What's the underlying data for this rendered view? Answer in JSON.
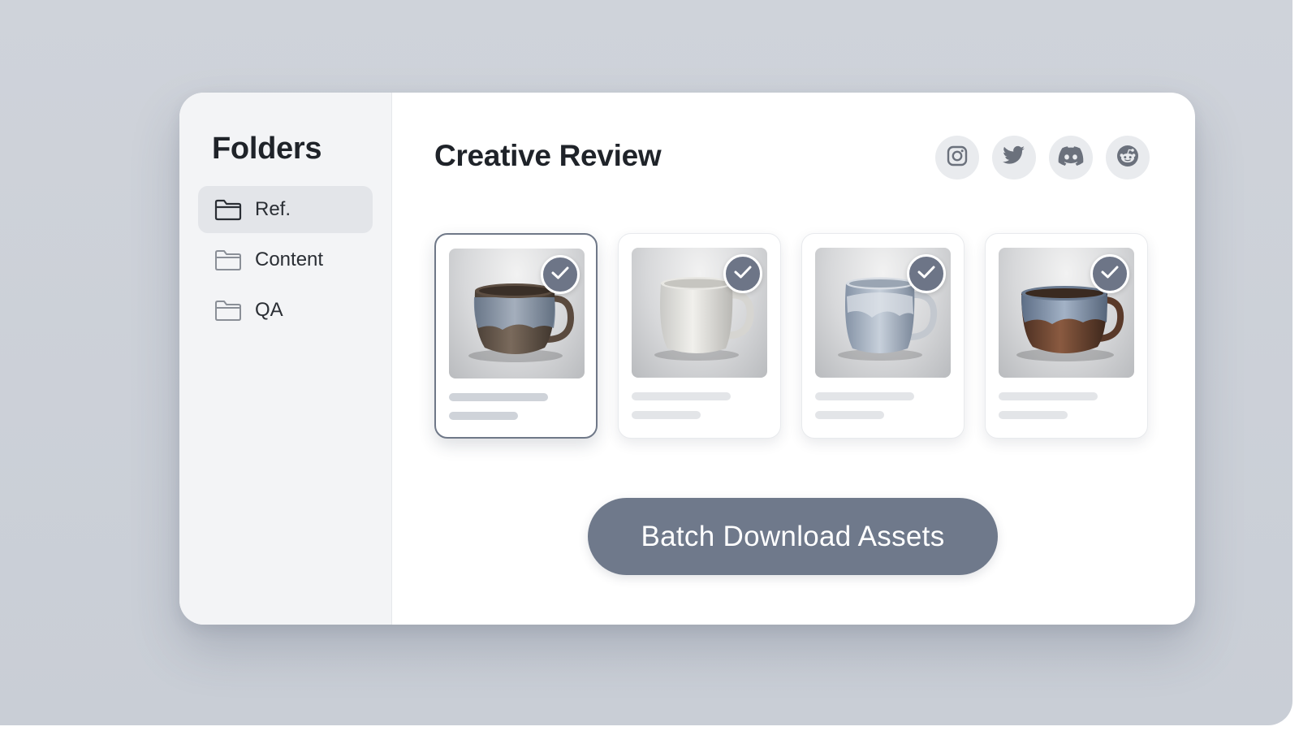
{
  "sidebar": {
    "title": "Folders",
    "items": [
      {
        "label": "Ref.",
        "icon": "folder-icon",
        "active": true
      },
      {
        "label": "Content",
        "icon": "folder-icon",
        "active": false
      },
      {
        "label": "QA",
        "icon": "folder-icon",
        "active": false
      }
    ]
  },
  "header": {
    "title": "Creative Review",
    "social": [
      "instagram-icon",
      "twitter-icon",
      "discord-icon",
      "reddit-icon"
    ]
  },
  "cards": [
    {
      "selected": true,
      "checked": true,
      "mug": "speckled-brown-blue-mug"
    },
    {
      "selected": false,
      "checked": true,
      "mug": "white-glazed-mug"
    },
    {
      "selected": false,
      "checked": true,
      "mug": "blue-speckled-tall-mug"
    },
    {
      "selected": false,
      "checked": true,
      "mug": "brown-blue-glaze-mug"
    }
  ],
  "actions": {
    "download_label": "Batch Download Assets"
  },
  "colors": {
    "accent": "#6f798b",
    "backdrop": "#cfd3da",
    "sidebar_bg": "#f3f4f6"
  }
}
